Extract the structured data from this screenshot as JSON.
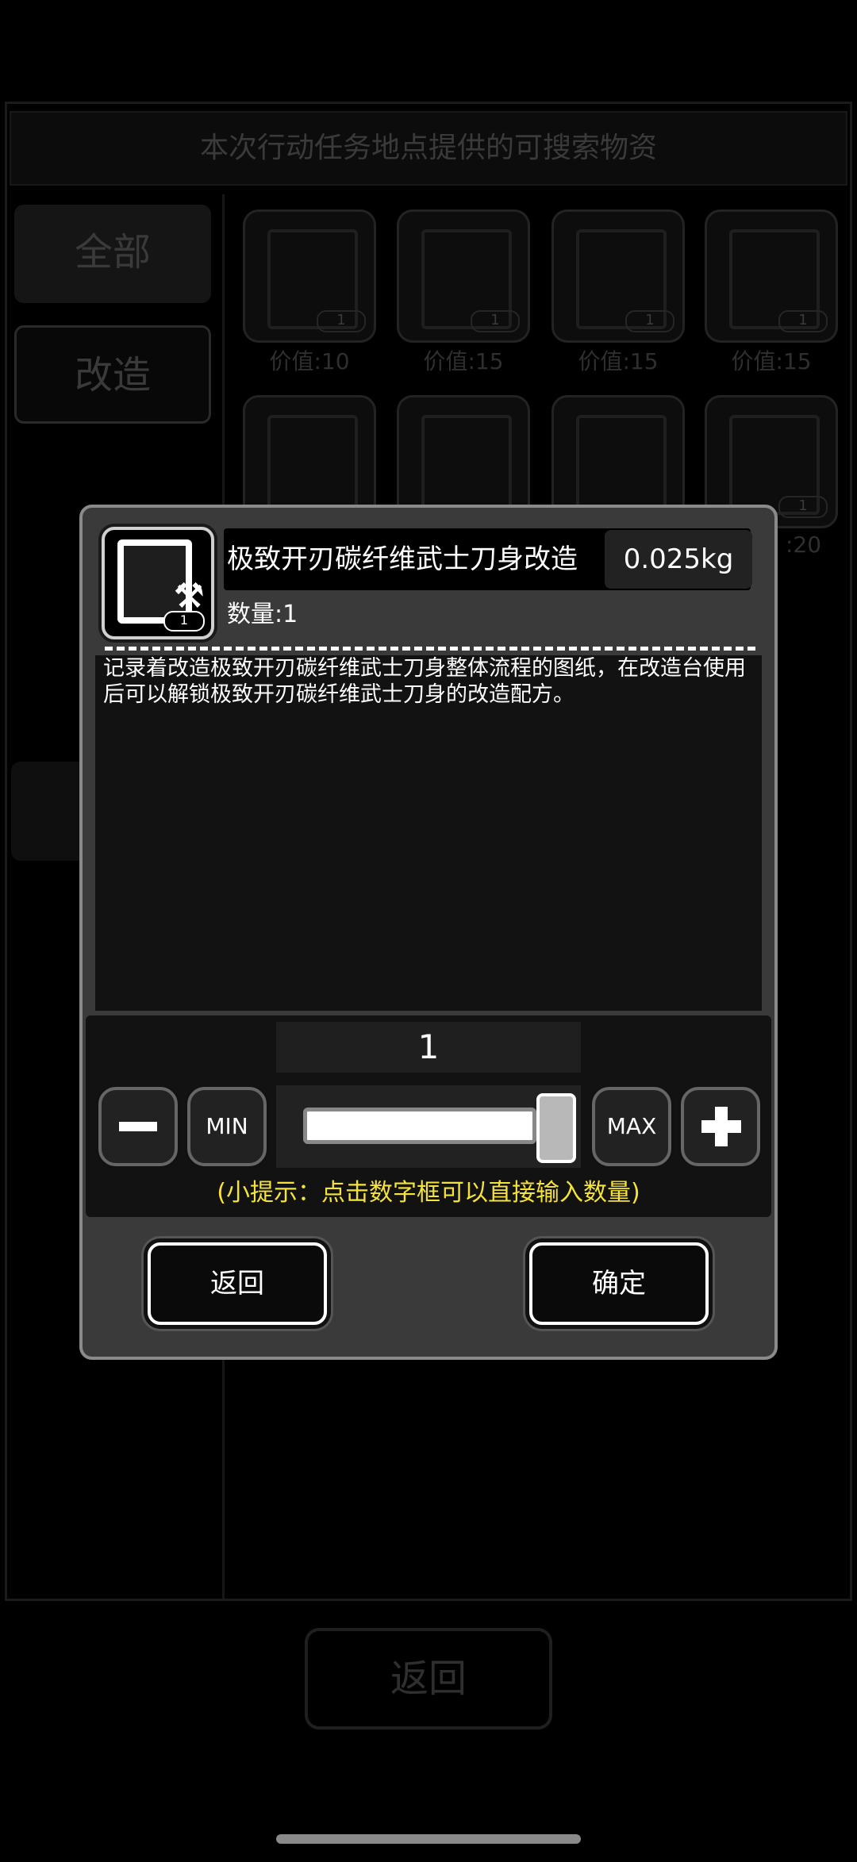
{
  "background": {
    "header_title": "本次行动任务地点提供的可搜索物资",
    "tabs": [
      "全部",
      "改造"
    ],
    "grid_values": [
      "价值:10",
      "价值:15",
      "价值:15",
      "价值:15"
    ],
    "partial_value": ":20",
    "item_qty": "1",
    "bottom_button": "返回"
  },
  "dialog": {
    "item_name": "极致开刃碳纤维武士刀身改造",
    "weight": "0.025kg",
    "count_label": "数量:1",
    "icon_qty": "1",
    "description": "记录着改造极致开刃碳纤维武士刀身整体流程的图纸，在改造台使用后可以解锁极致开刃碳纤维武士刀身的改造配方。",
    "quantity_value": "1",
    "slider_fraction": 1.0,
    "min_label": "MIN",
    "max_label": "MAX",
    "hint": "(小提示：点击数字框可以直接输入数量)",
    "back_label": "返回",
    "confirm_label": "确定"
  },
  "icons": {
    "minus": "minus-icon",
    "plus": "plus-icon",
    "item": "blueprint-document-icon",
    "wrench": "wrench-hammer-icon"
  },
  "colors": {
    "hint": "#f5e33b",
    "dialog_bg": "#3a3a3a",
    "dialog_border": "#8a8a8a"
  }
}
